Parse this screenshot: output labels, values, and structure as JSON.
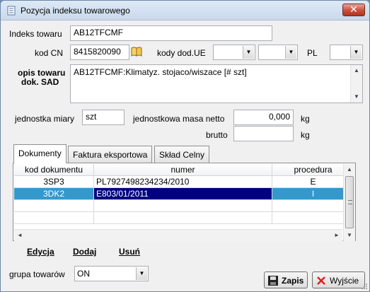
{
  "window": {
    "title": "Pozycja indeksu towarowego",
    "close_symbol": "✕"
  },
  "form": {
    "indeks_label": "Indeks towaru",
    "indeks_value": "AB12TFCMF",
    "kodcn_label": "kod CN",
    "kodcn_value": "8415820090",
    "kody_dod_label": "kody dod.UE",
    "kody_dod_1": "",
    "kody_dod_2": "",
    "pl_label": "PL",
    "pl_value": "",
    "opis_label_1": "opis towaru",
    "opis_label_2": "dok. SAD",
    "opis_value": "AB12TFCMF:Klimatyz. stojaco/wiszace [# szt]",
    "jednostka_label": "jednostka miary",
    "jednostka_value": "szt",
    "masa_label": "jednostkowa masa netto",
    "masa_netto_value": "0,000",
    "masa_unit": "kg",
    "brutto_label": "brutto",
    "brutto_value": "",
    "brutto_unit": "kg"
  },
  "tabs": [
    {
      "label": "Dokumenty",
      "active": true
    },
    {
      "label": "Faktura eksportowa",
      "active": false
    },
    {
      "label": "Skład Celny",
      "active": false
    }
  ],
  "grid": {
    "columns": [
      "kod dokumentu",
      "numer",
      "procedura"
    ],
    "rows": [
      {
        "kod": "3SP3",
        "numer": "PL7927498234234/2010",
        "procedura": "E",
        "selected": false
      },
      {
        "kod": "3DK2",
        "numer": "E803/01/2011",
        "procedura": "I",
        "selected": true
      }
    ]
  },
  "actions": {
    "edit": "Edycja",
    "add": "Dodaj",
    "delete": "Usuń"
  },
  "grupa": {
    "label": "grupa towarów",
    "value": "ON"
  },
  "buttons": {
    "save": "Zapis",
    "exit": "Wyjście"
  },
  "colors": {
    "selection": "#3399cc",
    "selection_focus": "#000080",
    "title_bar": "#dfe9f5",
    "close": "#c8503b"
  }
}
